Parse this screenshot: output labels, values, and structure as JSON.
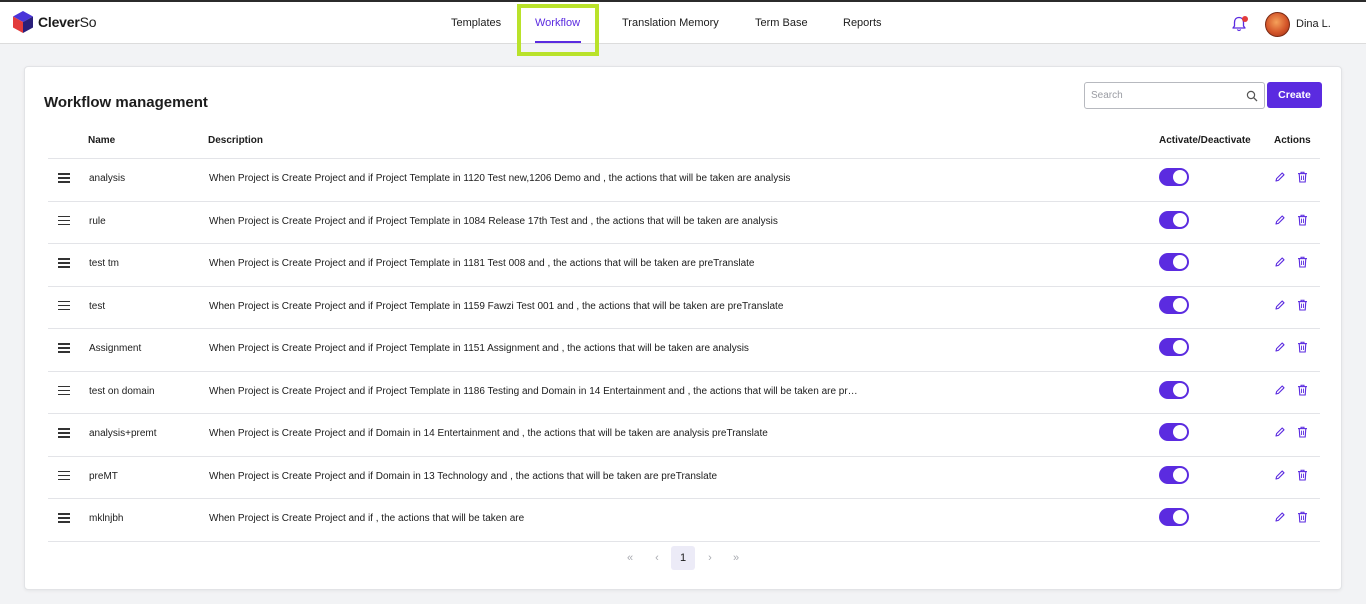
{
  "app": {
    "brand_bold": "Clever",
    "brand_thin": "So",
    "colors": {
      "accent": "#5b2be0",
      "highlight": "#b9e22a",
      "notification": "#e23b3b"
    }
  },
  "nav": {
    "items": [
      {
        "label": "Templates",
        "active": false
      },
      {
        "label": "Workflow",
        "active": true
      },
      {
        "label": "Translation Memory",
        "active": false
      },
      {
        "label": "Term Base",
        "active": false
      },
      {
        "label": "Reports",
        "active": false
      }
    ]
  },
  "user": {
    "name": "Dina L.",
    "icons": [
      "bell-icon",
      "avatar"
    ]
  },
  "page": {
    "title": "Workflow management",
    "search_placeholder": "Search",
    "create_label": "Create"
  },
  "table": {
    "headers": {
      "name": "Name",
      "description": "Description",
      "activate": "Activate/Deactivate",
      "actions": "Actions"
    },
    "rows": [
      {
        "name": "analysis",
        "description": "When Project is Create Project and if Project Template in 1120 Test new,1206 Demo and , the actions that will be taken are analysis",
        "active": true
      },
      {
        "name": "rule",
        "description": "When Project is Create Project and if Project Template in 1084 Release 17th Test and , the actions that will be taken are analysis",
        "active": true
      },
      {
        "name": "test tm",
        "description": "When Project is Create Project and if Project Template in 1181 Test 008 and , the actions that will be taken are preTranslate",
        "active": true
      },
      {
        "name": "test",
        "description": "When Project is Create Project and if Project Template in 1159 Fawzi Test 001 and , the actions that will be taken are preTranslate",
        "active": true
      },
      {
        "name": "Assignment",
        "description": "When Project is Create Project and if Project Template in 1151 Assignment and , the actions that will be taken are analysis",
        "active": true
      },
      {
        "name": "test on domain",
        "description": "When Project is Create Project and if Project Template in 1186 Testing and Domain in 14 Entertainment and , the actions that will be taken are pr…",
        "active": true
      },
      {
        "name": "analysis+premt",
        "description": "When Project is Create Project and if Domain in 14 Entertainment and , the actions that will be taken are analysis preTranslate",
        "active": true
      },
      {
        "name": "preMT",
        "description": "When Project is Create Project and if Domain in 13 Technology and , the actions that will be taken are preTranslate",
        "active": true
      },
      {
        "name": "mklnjbh",
        "description": "When Project is Create Project and if , the actions that will be taken are",
        "active": true
      }
    ]
  },
  "pagination": {
    "first": "«",
    "prev": "‹",
    "current": "1",
    "next": "›",
    "last": "»"
  }
}
